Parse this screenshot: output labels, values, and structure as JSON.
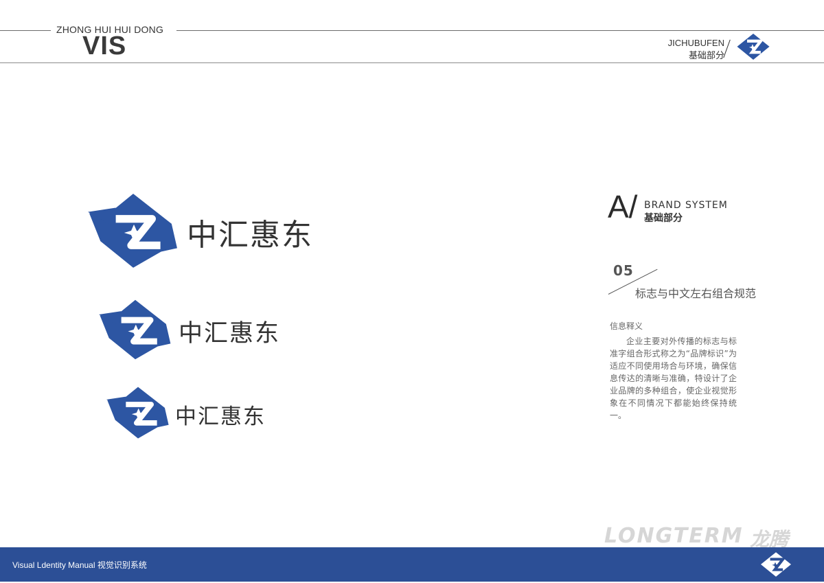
{
  "header": {
    "subtitle": "ZHONG HUI HUI DONG",
    "title": "VIS",
    "section_en": "JICHUBUFEN",
    "section_cn": "基础部分"
  },
  "logos": [
    {
      "name": "中汇惠东",
      "size": "large"
    },
    {
      "name": "中汇惠东",
      "size": "medium"
    },
    {
      "name": "中汇惠东",
      "size": "small"
    }
  ],
  "panel": {
    "letter": "A/",
    "system_en": "BRAND SYSTEM",
    "system_cn": "基础部分",
    "number": "05",
    "section_title": "标志与中文左右组合规范",
    "info_heading": "信息释义",
    "info_body": "企业主要对外传播的标志与标准字组合形式称之为“品牌标识”为适应不同使用场合与环境，确保信息传达的清晰与准确，特设计了企业品牌的多种组合，使企业视觉形象在不同情况下都能始终保持统一。"
  },
  "watermark": {
    "brand_en": "LONGTERM",
    "brand_cn": "龙腾"
  },
  "footer": {
    "text": "Visual Ldentity Manual  视觉识别系统"
  },
  "colors": {
    "brand_blue": "#2c4f96",
    "logo_blue": "#2d56a3"
  },
  "icons": [
    "zh-logo-icon"
  ]
}
